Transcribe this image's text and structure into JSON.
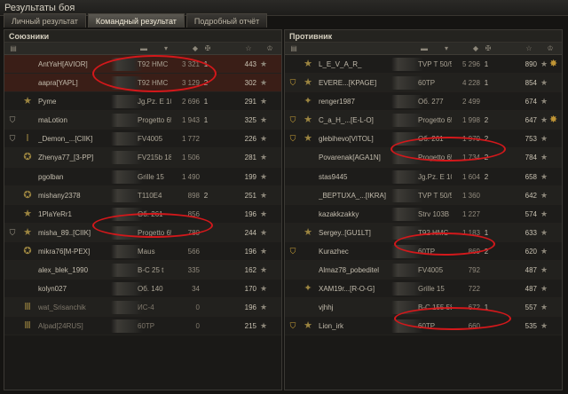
{
  "window": {
    "title": "Результаты боя"
  },
  "tabs": [
    {
      "label": "Личный результат",
      "active": false
    },
    {
      "label": "Командный результат",
      "active": true
    },
    {
      "label": "Подробный отчёт",
      "active": false
    }
  ],
  "header_icons": [
    "tier-icon",
    "tank-icon",
    "sort-chevron-icon",
    "damage-icon",
    "kills-icon",
    "xp-icon",
    "medal-icon"
  ],
  "allies": {
    "title": "Союзники",
    "rows": [
      {
        "badge": "",
        "rank": "",
        "name": "AntYaH[AVIOR]",
        "tank": "T92 HMC",
        "dmg": "3 321",
        "kills": "1",
        "xp": "443",
        "medal": "",
        "sel": true
      },
      {
        "badge": "",
        "rank": "",
        "name": "aapra[YAPL]",
        "tank": "T92 HMC",
        "dmg": "3 129",
        "kills": "2",
        "xp": "302",
        "medal": "",
        "sel": true
      },
      {
        "badge": "",
        "rank": "★",
        "name": "Pyme",
        "tank": "Jg.Pz. E 100",
        "dmg": "2 696",
        "kills": "1",
        "xp": "291",
        "medal": ""
      },
      {
        "badge": "⛉",
        "rank": "",
        "name": "maLotion",
        "tank": "Progetto 65",
        "dmg": "1 943",
        "kills": "1",
        "xp": "325",
        "medal": ""
      },
      {
        "badge": "⛉",
        "rank": "Ⅰ",
        "name": "_Demon_...[CIIK]",
        "tank": "FV4005",
        "dmg": "1 772",
        "kills": "",
        "xp": "226",
        "medal": ""
      },
      {
        "badge": "",
        "rank": "✪",
        "name": "Zhenya77_[3-PP]",
        "tank": "FV215b 183",
        "dmg": "1 506",
        "kills": "",
        "xp": "281",
        "medal": ""
      },
      {
        "badge": "",
        "rank": "",
        "name": "pgolban",
        "tank": "Grille 15",
        "dmg": "1 490",
        "kills": "",
        "xp": "199",
        "medal": ""
      },
      {
        "badge": "",
        "rank": "✪",
        "name": "mishany2378",
        "tank": "T110E4",
        "dmg": "898",
        "kills": "2",
        "xp": "251",
        "medal": ""
      },
      {
        "badge": "",
        "rank": "★",
        "name": "1PlaYeRr1",
        "tank": "Об. 261",
        "dmg": "856",
        "kills": "",
        "xp": "196",
        "medal": ""
      },
      {
        "badge": "⛉",
        "rank": "★",
        "name": "misha_89..[CIIK]",
        "tank": "Progetto 65",
        "dmg": "780",
        "kills": "",
        "xp": "244",
        "medal": ""
      },
      {
        "badge": "",
        "rank": "✪",
        "name": "mikra76[M-PEX]",
        "tank": "Maus",
        "dmg": "566",
        "kills": "",
        "xp": "196",
        "medal": ""
      },
      {
        "badge": "",
        "rank": "",
        "name": "alex_blek_1990",
        "tank": "В-С 25 t",
        "dmg": "335",
        "kills": "",
        "xp": "162",
        "medal": ""
      },
      {
        "badge": "",
        "rank": "",
        "name": "kolyn027",
        "tank": "Об. 140",
        "dmg": "34",
        "kills": "",
        "xp": "170",
        "medal": ""
      },
      {
        "badge": "",
        "rank": "Ⅲ",
        "name": "wat_Srisanchik",
        "tank": "ИС-4",
        "dmg": "0",
        "kills": "",
        "xp": "196",
        "medal": ""
      },
      {
        "badge": "",
        "rank": "Ⅲ",
        "name": "Alpad[24RUS]",
        "tank": "60TP",
        "dmg": "0",
        "kills": "",
        "xp": "215",
        "medal": ""
      }
    ]
  },
  "enemies": {
    "title": "Противник",
    "rows": [
      {
        "badge": "",
        "rank": "★",
        "name": "L_E_V_A_R_",
        "tank": "TVP T 50/51",
        "dmg": "5 296",
        "kills": "1",
        "xp": "890",
        "medal": "✸"
      },
      {
        "badge": "⛉",
        "rank": "★",
        "name": "EVERE...[KPAGE]",
        "tank": "60TP",
        "dmg": "4 228",
        "kills": "1",
        "xp": "854",
        "medal": ""
      },
      {
        "badge": "",
        "rank": "✦",
        "name": "renger1987",
        "tank": "Об. 277",
        "dmg": "2 499",
        "kills": "",
        "xp": "674",
        "medal": ""
      },
      {
        "badge": "⛉",
        "rank": "★",
        "name": "С_а_Н_...[E-L-O]",
        "tank": "Progetto 65",
        "dmg": "1 998",
        "kills": "2",
        "xp": "647",
        "medal": "✸"
      },
      {
        "badge": "⛉",
        "rank": "★",
        "name": "glebihevo[VITOL]",
        "tank": "Об. 261",
        "dmg": "1 979",
        "kills": "2",
        "xp": "753",
        "medal": ""
      },
      {
        "badge": "",
        "rank": "",
        "name": "Povarenak[AGA1N]",
        "tank": "Progetto 65",
        "dmg": "1 734",
        "kills": "2",
        "xp": "784",
        "medal": ""
      },
      {
        "badge": "",
        "rank": "",
        "name": "stas9445",
        "tank": "Jg.Pz. E 100",
        "dmg": "1 604",
        "kills": "2",
        "xp": "658",
        "medal": ""
      },
      {
        "badge": "",
        "rank": "",
        "name": "_BEPTUXA_...[IKRA]",
        "tank": "TVP T 50/51",
        "dmg": "1 360",
        "kills": "",
        "xp": "642",
        "medal": ""
      },
      {
        "badge": "",
        "rank": "",
        "name": "kazakkzakky",
        "tank": "Strv 103B",
        "dmg": "1 227",
        "kills": "",
        "xp": "574",
        "medal": ""
      },
      {
        "badge": "",
        "rank": "★",
        "name": "Sergey..[GU1LT]",
        "tank": "T92 HMC",
        "dmg": "1 183",
        "kills": "1",
        "xp": "633",
        "medal": ""
      },
      {
        "badge": "⛉",
        "rank": "",
        "name": "Kurazhec",
        "tank": "60TP",
        "dmg": "869",
        "kills": "2",
        "xp": "620",
        "medal": ""
      },
      {
        "badge": "",
        "rank": "",
        "name": "Almaz78_pobeditel",
        "tank": "FV4005",
        "dmg": "792",
        "kills": "",
        "xp": "487",
        "medal": ""
      },
      {
        "badge": "",
        "rank": "✦",
        "name": "XAM19r...[R-O-G]",
        "tank": "Grille 15",
        "dmg": "722",
        "kills": "",
        "xp": "487",
        "medal": ""
      },
      {
        "badge": "",
        "rank": "",
        "name": "vjhhj",
        "tank": "В-С 155 58",
        "dmg": "672",
        "kills": "1",
        "xp": "557",
        "medal": ""
      },
      {
        "badge": "⛉",
        "rank": "★",
        "name": "Lion_irk",
        "tank": "60TP",
        "dmg": "660",
        "kills": "",
        "xp": "535",
        "medal": ""
      }
    ]
  },
  "colors": {
    "annotation": "#d3181b",
    "selected_row": "#3a1e17"
  }
}
